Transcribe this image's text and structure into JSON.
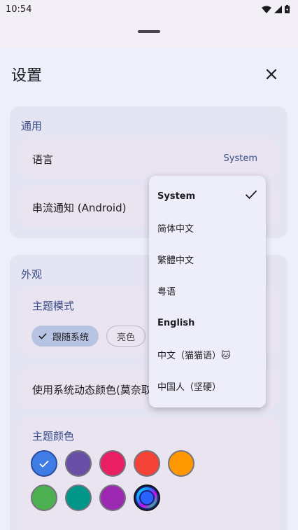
{
  "status_bar": {
    "time": "10:54"
  },
  "header": {
    "title": "设置",
    "close_icon": "close-icon"
  },
  "general": {
    "title": "通用",
    "language": {
      "label": "语言",
      "value": "System"
    },
    "stream_notification": {
      "label": "串流通知 (Android)"
    }
  },
  "appearance": {
    "title": "外观",
    "theme_mode": {
      "title": "主题模式",
      "chips": [
        {
          "label": "跟随系统",
          "selected": true
        },
        {
          "label": "亮色",
          "selected": false
        }
      ]
    },
    "dynamic_color": {
      "label": "使用系统动态颜色(莫奈取色)"
    },
    "theme_color": {
      "title": "主题颜色",
      "swatches": [
        "#3F7CE6",
        "#6A4FA6",
        "#E91E63",
        "#F44336",
        "#FF9800",
        "#4CAF50",
        "#009688",
        "#9C27B0",
        "dynamic"
      ],
      "selected_index": 0
    }
  },
  "language_menu": {
    "items": [
      {
        "label": "System",
        "selected": true
      },
      {
        "label": "简体中文"
      },
      {
        "label": "繁體中文"
      },
      {
        "label": "粤语"
      },
      {
        "label": "English"
      },
      {
        "label": "中文（猫猫语）🐱"
      },
      {
        "label": "中国人（坚硬）"
      }
    ]
  }
}
